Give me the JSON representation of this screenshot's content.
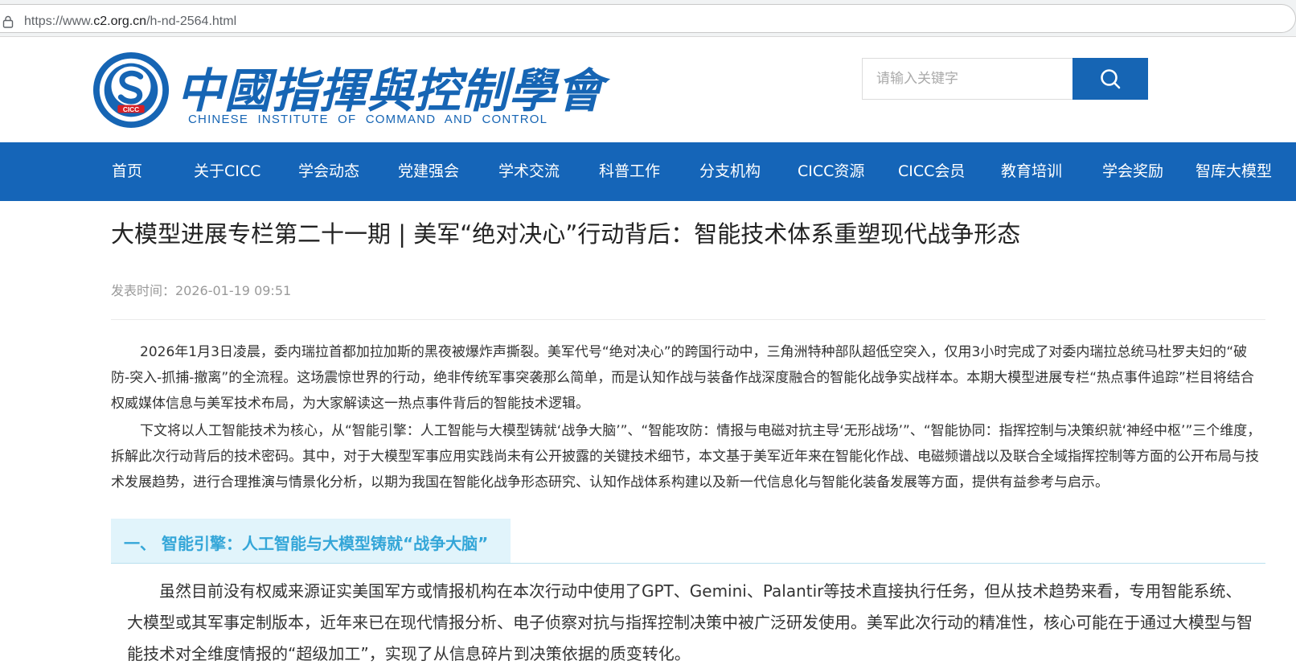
{
  "browser": {
    "url_prefix": "https://www.",
    "url_domain": "c2.org.cn",
    "url_path": "/h-nd-2564.html"
  },
  "header": {
    "logo_cn": "中國指揮與控制學會",
    "logo_en": "CHINESE INSTITUTE OF COMMAND AND CONTROL",
    "logo_badge": "CICC",
    "search_placeholder": "请输入关键字"
  },
  "nav": {
    "items": [
      {
        "label": "首页"
      },
      {
        "label": "关于CICC"
      },
      {
        "label": "学会动态"
      },
      {
        "label": "党建强会"
      },
      {
        "label": "学术交流"
      },
      {
        "label": "科普工作"
      },
      {
        "label": "分支机构"
      },
      {
        "label": "CICC资源"
      },
      {
        "label": "CICC会员"
      },
      {
        "label": "教育培训"
      },
      {
        "label": "学会奖励"
      },
      {
        "label": "智库大模型"
      }
    ]
  },
  "article": {
    "title": "大模型进展专栏第二十一期 | 美军“绝对决心”行动背后：智能技术体系重塑现代战争形态",
    "publish_time": "发表时间：2026-01-19 09:51",
    "paragraphs": [
      "2026年1月3日凌晨，委内瑞拉首都加拉加斯的黑夜被爆炸声撕裂。美军代号“绝对决心”的跨国行动中，三角洲特种部队超低空突入，仅用3小时完成了对委内瑞拉总统马杜罗夫妇的“破防-突入-抓捕-撤离”的全流程。这场震惊世界的行动，绝非传统军事突袭那么简单，而是认知作战与装备作战深度融合的智能化战争实战样本。本期大模型进展专栏“热点事件追踪”栏目将结合权威媒体信息与美军技术布局，为大家解读这一热点事件背后的智能技术逻辑。",
      "下文将以人工智能技术为核心，从“智能引擎：人工智能与大模型铸就‘战争大脑’”、“智能攻防：情报与电磁对抗主导‘无形战场’”、“智能协同：指挥控制与决策织就‘神经中枢’”三个维度，拆解此次行动背后的技术密码。其中，对于大模型军事应用实践尚未有公开披露的关键技术细节，本文基于美军近年来在智能化作战、电磁频谱战以及联合全域指挥控制等方面的公开布局与技术发展趋势，进行合理推演与情景化分析，以期为我国在智能化战争形态研究、认知作战体系构建以及新一代信息化与智能化装备发展等方面，提供有益参考与启示。"
    ],
    "section_heading": "一、 智能引擎：人工智能与大模型铸就“战争大脑”",
    "section_paragraph": "虽然目前没有权威来源证实美国军方或情报机构在本次行动中使用了GPT、Gemini、Palantir等技术直接执行任务，但从技术趋势来看，专用智能系统、大模型或其军事定制版本，近年来已在现代情报分析、电子侦察对抗与指挥控制决策中被广泛研发使用。美军此次行动的精准性，核心可能在于通过大模型与智能技术对全维度情报的“超级加工”，实现了从信息碎片到决策依据的质变转化。"
  },
  "colors": {
    "brand_blue": "#1565b8",
    "section_text": "#34a6d8",
    "section_bg": "#e1f4fb"
  },
  "icons": {
    "address_bar": "lock-icon",
    "search": "search-icon"
  }
}
